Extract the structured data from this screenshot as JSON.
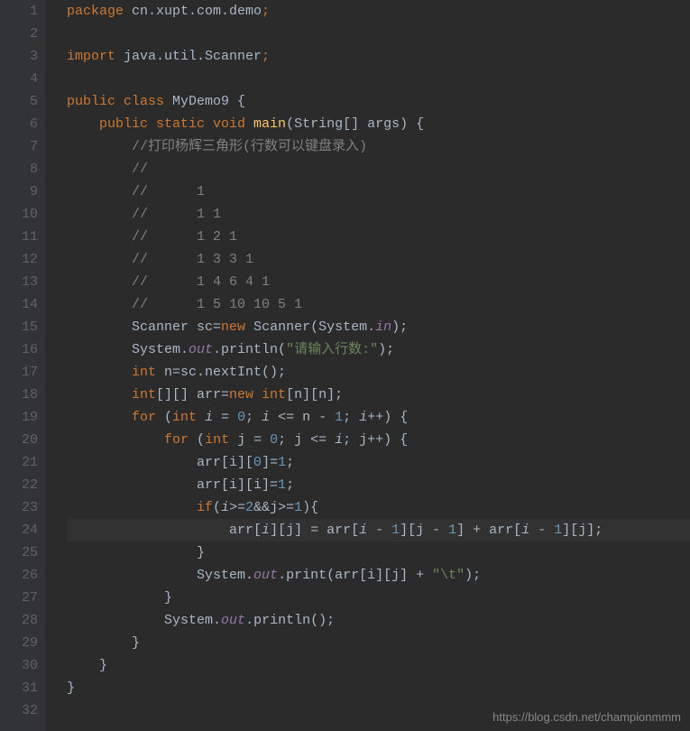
{
  "gutter": {
    "start": 1,
    "end": 32
  },
  "code": {
    "l1": {
      "kw1": "package ",
      "pkg": "cn.xupt.com.demo",
      "semi": ";"
    },
    "l2": "",
    "l3": {
      "kw1": "import ",
      "pkg": "java.util.Scanner",
      "semi": ";"
    },
    "l4": "",
    "l5": {
      "kw1": "public class ",
      "name": "MyDemo9 ",
      "brace": "{"
    },
    "l6": {
      "kw1": "public static void ",
      "name": "main",
      "params": "(String[] args) ",
      "brace": "{"
    },
    "l7": "//打印杨辉三角形(行数可以键盘录入)",
    "l8": "//",
    "l9": "//      1",
    "l10": "//      1 1",
    "l11": "//      1 2 1",
    "l12": "//      1 3 3 1",
    "l13": "//      1 4 6 4 1",
    "l14": "//      1 5 10 10 5 1",
    "l15": {
      "p1": "Scanner sc=",
      "kw": "new ",
      "p2": "Scanner(System.",
      "field": "in",
      "p3": ");"
    },
    "l16": {
      "p1": "System.",
      "field": "out",
      "p2": ".println(",
      "str": "\"请输入行数:\"",
      "p3": ");"
    },
    "l17": {
      "kw": "int ",
      "p1": "n=sc.nextInt();"
    },
    "l18": {
      "kw1": "int",
      "p1": "[][] arr=",
      "kw2": "new int",
      "p2": "[n][n];"
    },
    "l19": {
      "kw1": "for ",
      "p1": "(",
      "kw2": "int ",
      "var1": "i",
      "p2": " = ",
      "n1": "0",
      "p3": "; ",
      "var2": "i",
      "p4": " <= n - ",
      "n2": "1",
      "p5": "; ",
      "var3": "i",
      "p6": "++) {"
    },
    "l20": {
      "kw1": "for ",
      "p1": "(",
      "kw2": "int ",
      "p2": "j = ",
      "n1": "0",
      "p3": "; j <= ",
      "var1": "i",
      "p4": "; j++) {"
    },
    "l21": {
      "p1": "arr[i][",
      "n1": "0",
      "p2": "]=",
      "n2": "1",
      "p3": ";"
    },
    "l22": {
      "p1": "arr[i][i]=",
      "n1": "1",
      "p2": ";"
    },
    "l23": {
      "kw": "if",
      "p1": "(",
      "var1": "i",
      "p2": ">=",
      "n1": "2",
      "p3": "&&j>=",
      "n2": "1",
      "p4": "){"
    },
    "l24": {
      "p1": "arr[",
      "var1": "i",
      "p2": "][j] = arr[",
      "var2": "i",
      "p3": " - ",
      "n1": "1",
      "p4": "][j - ",
      "n2": "1",
      "p5": "] + arr[",
      "var3": "i",
      "p6": " - ",
      "n3": "1",
      "p7": "][j];"
    },
    "l25": "}",
    "l26": {
      "p1": "System.",
      "field": "out",
      "p2": ".print(arr[i][j] + ",
      "str": "\"\\t\"",
      "p3": ");"
    },
    "l27": "}",
    "l28": {
      "p1": "System.",
      "field": "out",
      "p2": ".println();"
    },
    "l29": "}",
    "l30": "}",
    "l31": "}",
    "l32": ""
  },
  "watermark": "https://blog.csdn.net/championmmm"
}
